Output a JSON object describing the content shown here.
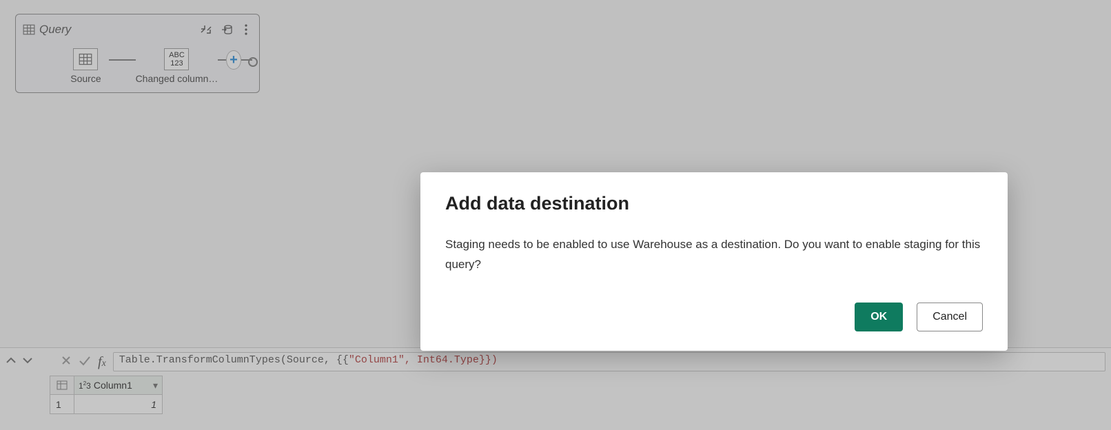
{
  "query_card": {
    "title": "Query",
    "steps": [
      {
        "label": "Source",
        "icon": "table"
      },
      {
        "label": "Changed column…",
        "icon": "abc123"
      }
    ]
  },
  "formula_bar": {
    "expression_prefix": "Table.TransformColumnTypes(Source, {{",
    "expression_string": "\"Column1\", Int64.Type}})"
  },
  "preview": {
    "column_header": "Column1",
    "row_index": "1",
    "cell_value": "1"
  },
  "dialog": {
    "title": "Add data destination",
    "body": "Staging needs to be enabled to use Warehouse as a destination. Do you want to enable staging for this query?",
    "ok_label": "OK",
    "cancel_label": "Cancel"
  }
}
